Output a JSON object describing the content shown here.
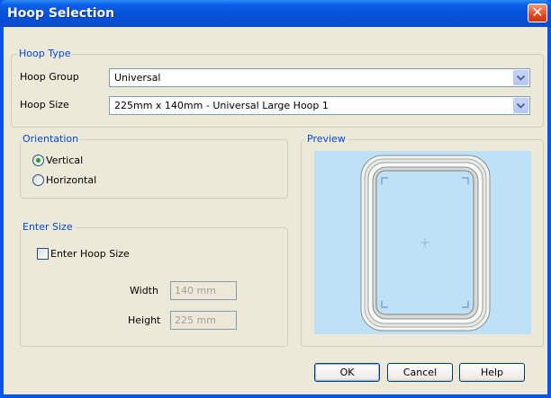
{
  "window": {
    "title": "Hoop Selection",
    "close_glyph": "✕"
  },
  "hoop_type": {
    "legend": "Hoop Type",
    "group_label": "Hoop Group",
    "group_value": "Universal",
    "size_label": "Hoop Size",
    "size_value": "225mm x 140mm - Universal Large Hoop 1"
  },
  "orientation": {
    "legend": "Orientation",
    "vertical_label": "Vertical",
    "horizontal_label": "Horizontal",
    "selected": "Vertical"
  },
  "enter_size": {
    "legend": "Enter Size",
    "checkbox_label": "Enter Hoop Size",
    "checked": false,
    "width_label": "Width",
    "width_value": "140 mm",
    "height_label": "Height",
    "height_value": "225 mm"
  },
  "preview": {
    "legend": "Preview"
  },
  "buttons": {
    "ok": "OK",
    "cancel": "Cancel",
    "help": "Help"
  },
  "colors": {
    "accent": "#0046d5",
    "title_bar": "#0551d9",
    "dialog_bg": "#ece9d8",
    "preview_bg": "#bfe1f6"
  },
  "icons": {
    "combo_arrow": "chevron-down-icon",
    "close": "close-icon"
  }
}
